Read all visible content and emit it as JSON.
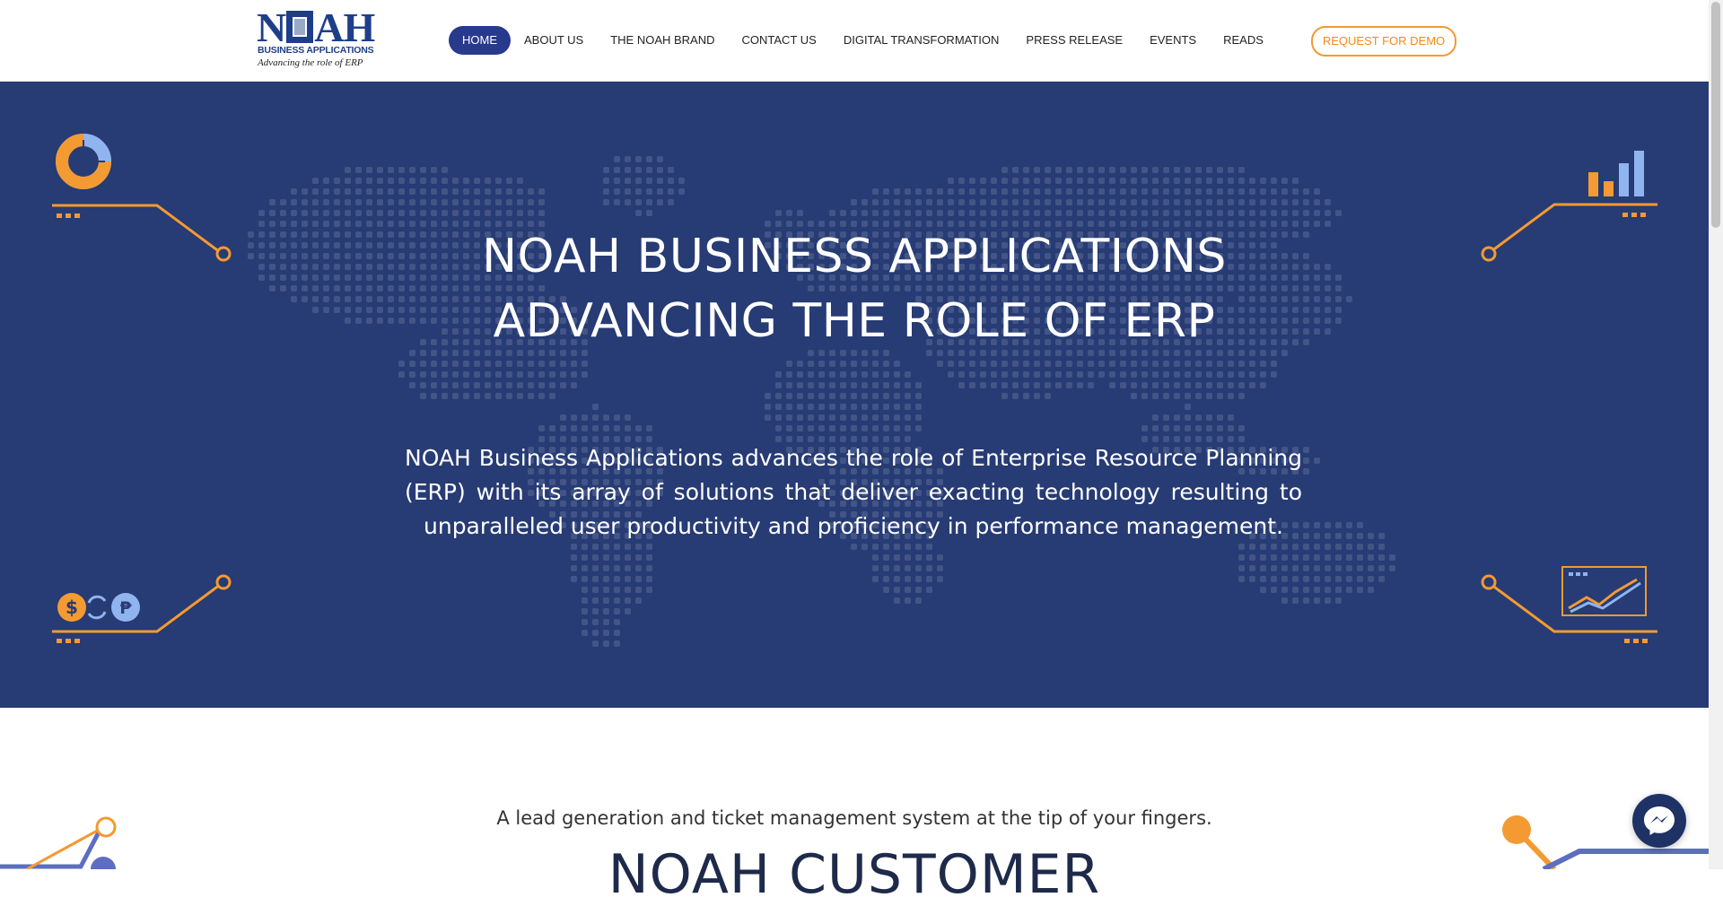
{
  "logo": {
    "wordmark": "NOAH",
    "subtitle": "BUSINESS APPLICATIONS",
    "tagline": "Advancing the role of  ERP"
  },
  "nav": {
    "items": [
      {
        "label": "HOME",
        "active": true
      },
      {
        "label": "ABOUT US"
      },
      {
        "label": "THE NOAH BRAND"
      },
      {
        "label": "CONTACT US"
      },
      {
        "label": "DIGITAL TRANSFORMATION"
      },
      {
        "label": "PRESS RELEASE"
      },
      {
        "label": "EVENTS"
      },
      {
        "label": "READS"
      }
    ],
    "demo_label": "REQUEST FOR DEMO"
  },
  "hero": {
    "title_line1": "NOAH BUSINESS APPLICATIONS",
    "title_line2": "ADVANCING THE ROLE OF ERP",
    "description": "NOAH Business Applications advances the role of Enterprise Resource Planning (ERP) with its array of solutions that deliver exacting technology resulting to unparalleled user productivity and proficiency in performance management."
  },
  "section": {
    "lead": "A lead generation and ticket management system at the tip of your fingers.",
    "title": "NOAH CUSTOMER"
  },
  "icons": {
    "donut": "donut-chart-icon",
    "bars": "bar-chart-icon",
    "currency": "currency-exchange-icon",
    "linechart": "line-chart-icon",
    "messenger": "messenger-icon"
  },
  "colors": {
    "brand_blue": "#283a8c",
    "hero_bg": "#273b74",
    "accent_orange": "#f39a32",
    "light_blue": "#8fb4f0"
  }
}
